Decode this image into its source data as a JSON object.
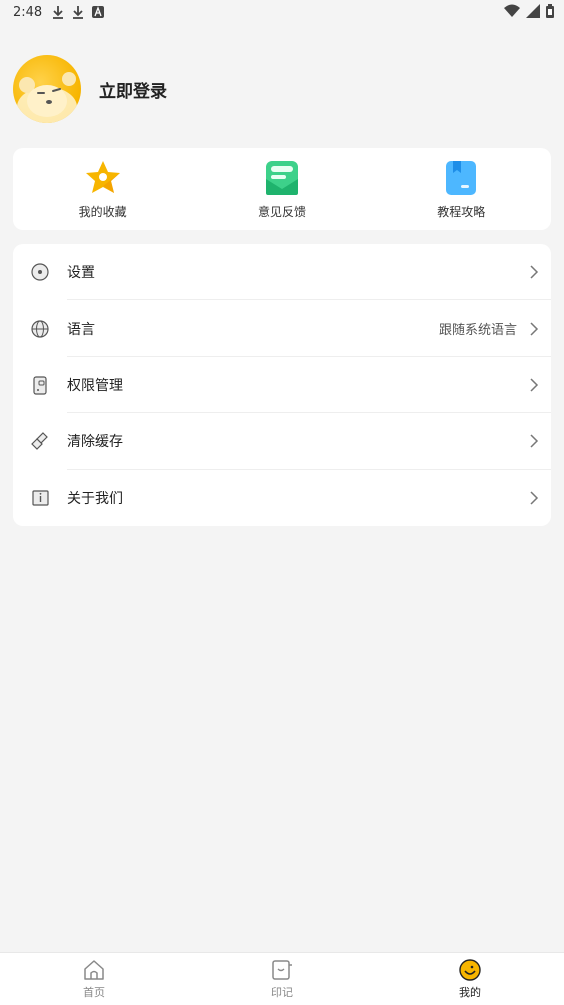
{
  "status_bar": {
    "time": "2:48",
    "icons_left": [
      "download-icon",
      "download-icon",
      "a-icon"
    ],
    "icons_right": [
      "wifi-icon",
      "signal-icon",
      "battery-icon"
    ]
  },
  "profile": {
    "login_label": "立即登录",
    "avatar_icon": "bear-avatar-icon"
  },
  "quick_actions": [
    {
      "label": "我的收藏",
      "icon": "star-icon",
      "color": "#f7b500"
    },
    {
      "label": "意见反馈",
      "icon": "feedback-icon",
      "color": "#3dd18a"
    },
    {
      "label": "教程攻略",
      "icon": "book-icon",
      "color": "#4db7ff"
    }
  ],
  "menu": [
    {
      "label": "设置",
      "icon": "settings-icon",
      "value": ""
    },
    {
      "label": "语言",
      "icon": "globe-icon",
      "value": "跟随系统语言"
    },
    {
      "label": "权限管理",
      "icon": "permission-icon",
      "value": ""
    },
    {
      "label": "清除缓存",
      "icon": "broom-icon",
      "value": ""
    },
    {
      "label": "关于我们",
      "icon": "info-icon",
      "value": ""
    }
  ],
  "tabs": [
    {
      "label": "首页",
      "icon": "home-icon",
      "active": false
    },
    {
      "label": "印记",
      "icon": "stamp-icon",
      "active": false
    },
    {
      "label": "我的",
      "icon": "me-icon",
      "active": true
    }
  ],
  "colors": {
    "accent": "#f7b500",
    "background": "#f4f4f4"
  }
}
